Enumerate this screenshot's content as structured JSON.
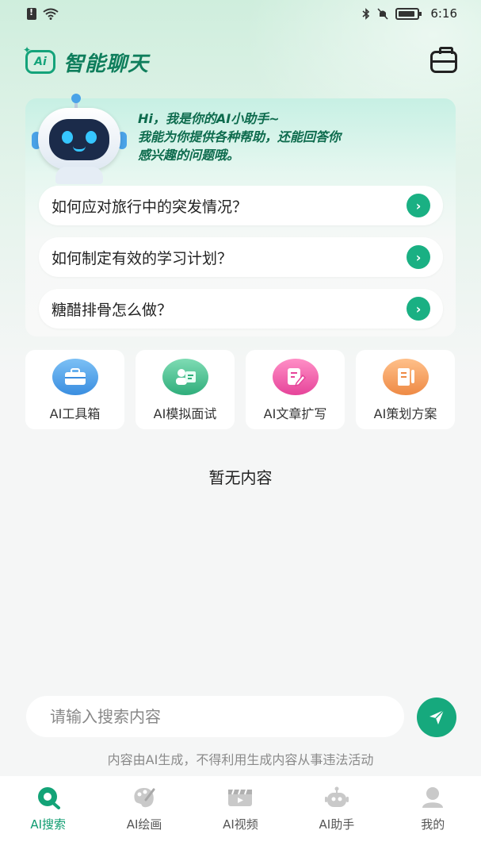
{
  "status_bar": {
    "time": "6:16"
  },
  "header": {
    "title": "智能聊天",
    "logo_text": "Ai"
  },
  "greeting": {
    "line1": "Hi，我是你的AI小助手~",
    "line2": "我能为你提供各种帮助，还能回答你",
    "line3": "感兴趣的问题哦。"
  },
  "questions": [
    {
      "text": "如何应对旅行中的突发情况？"
    },
    {
      "text": "如何制定有效的学习计划？"
    },
    {
      "text": "糖醋排骨怎么做？"
    }
  ],
  "features": [
    {
      "label": "AI工具箱",
      "icon": "briefcase-icon",
      "color": "#4a9be8"
    },
    {
      "label": "AI模拟面试",
      "icon": "interview-icon",
      "color": "#3fbf8a"
    },
    {
      "label": "AI文章扩写",
      "icon": "edit-document-icon",
      "color": "#f05aa8"
    },
    {
      "label": "AI策划方案",
      "icon": "notebook-icon",
      "color": "#f59a55"
    }
  ],
  "empty_state": "暂无内容",
  "search": {
    "placeholder": "请输入搜索内容"
  },
  "disclaimer": "内容由AI生成，不得利用生成内容从事违法活动",
  "nav": [
    {
      "label": "AI搜索",
      "icon": "search-icon",
      "active": true
    },
    {
      "label": "AI绘画",
      "icon": "palette-icon",
      "active": false
    },
    {
      "label": "AI视频",
      "icon": "video-icon",
      "active": false
    },
    {
      "label": "AI助手",
      "icon": "robot-icon",
      "active": false
    },
    {
      "label": "我的",
      "icon": "profile-icon",
      "active": false
    }
  ],
  "colors": {
    "brand": "#14a37a",
    "accent": "#1ab083"
  }
}
